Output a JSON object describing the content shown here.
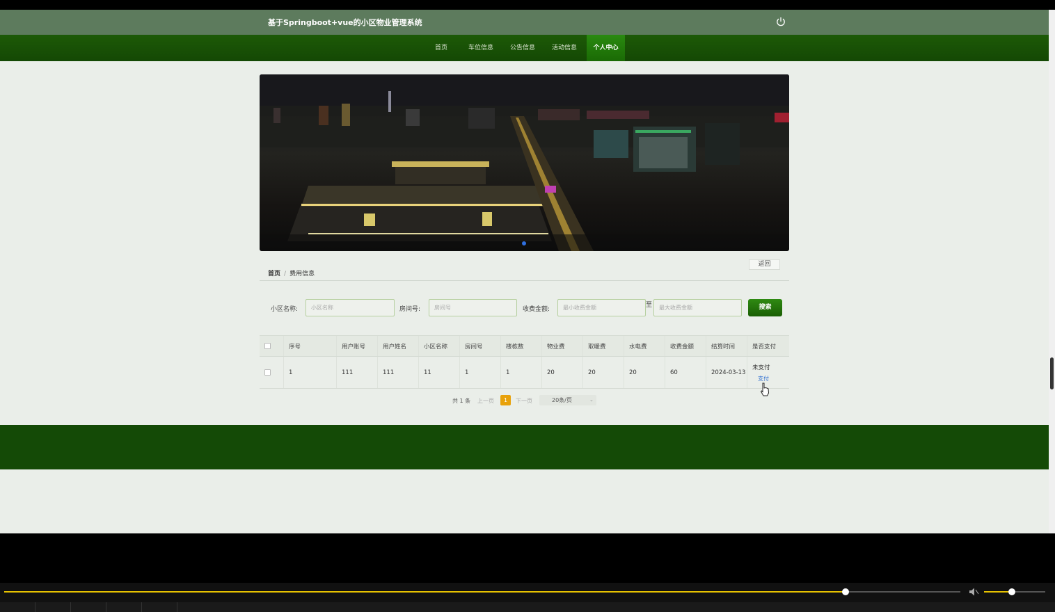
{
  "header": {
    "title": "基于Springboot+vue的小区物业管理系统"
  },
  "nav": {
    "items": [
      {
        "label": "首页",
        "active": false
      },
      {
        "label": "车位信息",
        "active": false
      },
      {
        "label": "公告信息",
        "active": false
      },
      {
        "label": "活动信息",
        "active": false
      },
      {
        "label": "个人中心",
        "active": true
      }
    ]
  },
  "breadcrumb": {
    "home": "首页",
    "separator": "/",
    "current": "费用信息"
  },
  "back_button": "返回",
  "filters": {
    "community_label": "小区名称:",
    "community_placeholder": "小区名称",
    "room_label": "房间号:",
    "room_placeholder": "房间号",
    "amount_label": "收费金额:",
    "min_placeholder": "最小收费金额",
    "range_separator": "至",
    "max_placeholder": "最大收费金额",
    "search_button": "搜索"
  },
  "table": {
    "columns": [
      "序号",
      "用户账号",
      "用户姓名",
      "小区名称",
      "房间号",
      "楼栋数",
      "物业费",
      "取暖费",
      "水电费",
      "收费金额",
      "结算时间",
      "是否支付"
    ],
    "rows": [
      {
        "cells": [
          "1",
          "111",
          "111",
          "11",
          "1",
          "1",
          "20",
          "20",
          "20",
          "60",
          "2024-03-13"
        ],
        "status": "未支付",
        "action": "支付"
      }
    ]
  },
  "pagination": {
    "total": "共 1 条",
    "prev": "上一页",
    "current_page": "1",
    "next": "下一页",
    "page_size": "20条/页"
  },
  "video_player": {
    "progress": 0.88,
    "volume": 0.45
  },
  "colors": {
    "nav_green": "#144804",
    "accent": "#2a8a10",
    "page_badge": "#e8a10a"
  }
}
